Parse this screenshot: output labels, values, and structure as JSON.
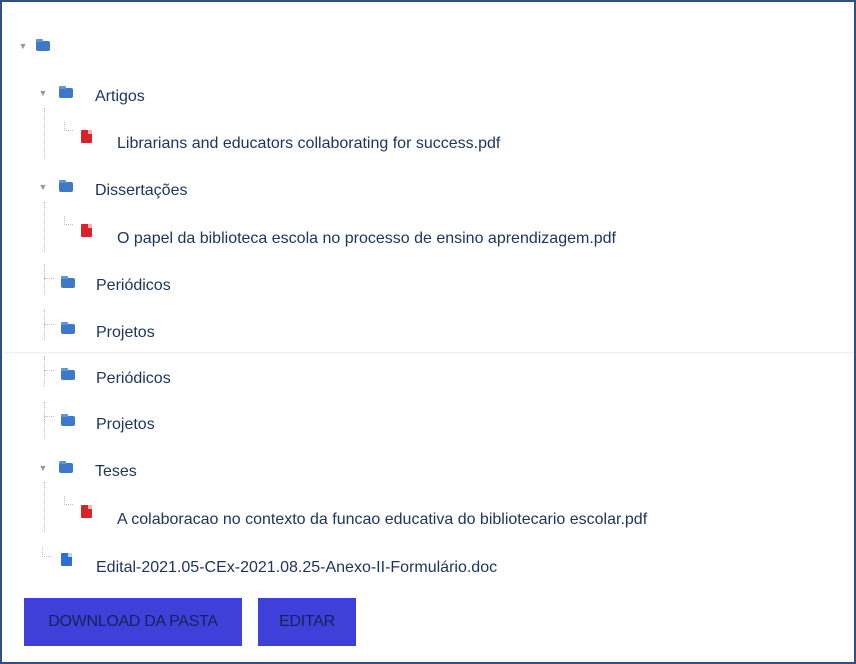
{
  "tree": {
    "root": {
      "label": ""
    },
    "items": [
      {
        "label": "Artigos"
      },
      {
        "label": "Librarians and educators collaborating for success.pdf"
      },
      {
        "label": "Dissertações"
      },
      {
        "label": "O papel da biblioteca escola no processo de ensino aprendizagem.pdf"
      },
      {
        "label": "Periódicos"
      },
      {
        "label": "Projetos"
      },
      {
        "label": "Periódicos"
      },
      {
        "label": "Projetos"
      },
      {
        "label": "Teses"
      },
      {
        "label": "A colaboracao no contexto da funcao educativa do bibliotecario escolar.pdf"
      },
      {
        "label": "Edital-2021.05-CEx-2021.08.25-Anexo-II-Formulário.doc"
      }
    ]
  },
  "actions": {
    "download_label": "DOWNLOAD DA PASTA",
    "edit_label": "EDITAR"
  },
  "colors": {
    "frame_border": "#2f4f86",
    "button_bg": "#3f3fd9",
    "text": "#1e3560",
    "folder": "#3d79c8",
    "pdf": "#d7242a"
  }
}
